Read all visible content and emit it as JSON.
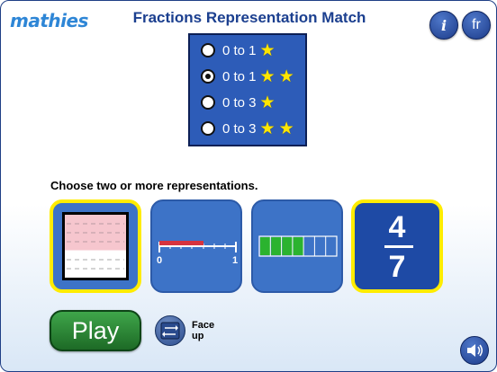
{
  "header": {
    "logo": "mathies",
    "title": "Fractions Representation Match",
    "info_label": "i",
    "lang_label": "fr"
  },
  "options": [
    {
      "label": "0 to 1",
      "stars": 1,
      "selected": false
    },
    {
      "label": "0 to 1",
      "stars": 2,
      "selected": true
    },
    {
      "label": "0 to 3",
      "stars": 1,
      "selected": false
    },
    {
      "label": "0 to 3",
      "stars": 2,
      "selected": false
    }
  ],
  "prompt": "Choose two or more representations.",
  "representations": {
    "area": {
      "selected": true,
      "fraction": "4/7"
    },
    "number_line": {
      "selected": false,
      "start": "0",
      "end": "1",
      "value": 0.5714
    },
    "strip": {
      "selected": false,
      "filled": 4,
      "parts": 7
    },
    "symbolic": {
      "selected": true,
      "numerator": "4",
      "denominator": "7"
    }
  },
  "controls": {
    "play_label": "Play",
    "face_up_line1": "Face",
    "face_up_line2": "up"
  },
  "colors": {
    "accent": "#2d5cb8",
    "selected_border": "#ffec00",
    "play_green": "#2f8b39",
    "area_fill": "#f6c6ce",
    "strip_fill": "#2bb32f"
  },
  "icons": [
    "info-icon",
    "swap-arrows-icon",
    "speaker-icon",
    "star-icon"
  ]
}
